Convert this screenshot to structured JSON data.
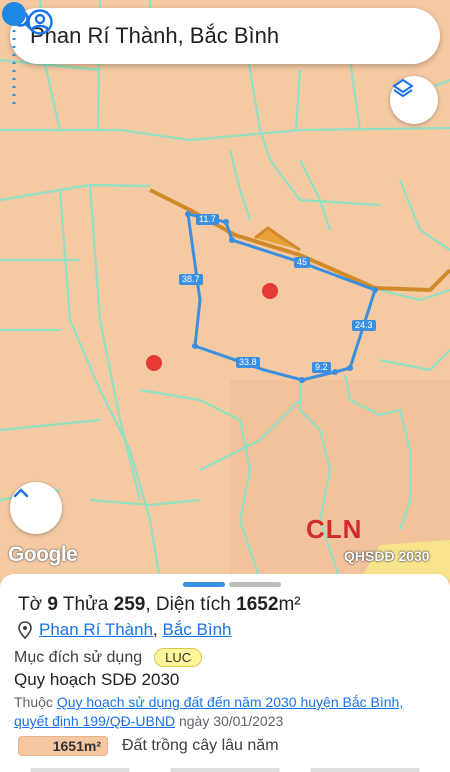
{
  "search": {
    "title": "Phan Rí Thành, Bắc Bình"
  },
  "icons": {
    "account": "account-circle-icon",
    "search": "search-icon",
    "layers": "layers-icon",
    "up": "chevron-up-icon",
    "location": "location-pin-icon"
  },
  "map": {
    "edge_labels": [
      "11.7",
      "45",
      "38.7",
      "24.3",
      "33.8",
      "9.2"
    ],
    "zone_label": "CLN",
    "attribution": "Google",
    "layer_tag": "QHSDĐ 2030"
  },
  "parcel": {
    "to_label": "Tờ",
    "to_value": "9",
    "thua_label": "Thửa",
    "thua_value": "259",
    "dien_tich_label": "Diện tích",
    "dien_tich_value": "1652",
    "unit": "m²",
    "location_ward": "Phan Rí Thành",
    "location_district": "Bắc Bình",
    "purpose_label": "Mục đích sử dụng",
    "purpose_badge": "LUC",
    "plan_title": "Quy hoạch SDĐ 2030",
    "belongs_prefix": "Thuộc",
    "plan_link": "Quy hoạch sử dụng đất đến năm 2030 huyện Bắc Bình, quyết định 199/QĐ-UBND",
    "date_text": "ngày 30/01/2023",
    "area_chip": "1651m²",
    "area_type": "Đất trồng cây lâu năm"
  },
  "colors": {
    "accent": "#3b8fe0",
    "map_bg": "#f5c9a2",
    "boundary": "#8fe0c4",
    "road": "#d18a2b",
    "zone": "#d12b2b"
  }
}
